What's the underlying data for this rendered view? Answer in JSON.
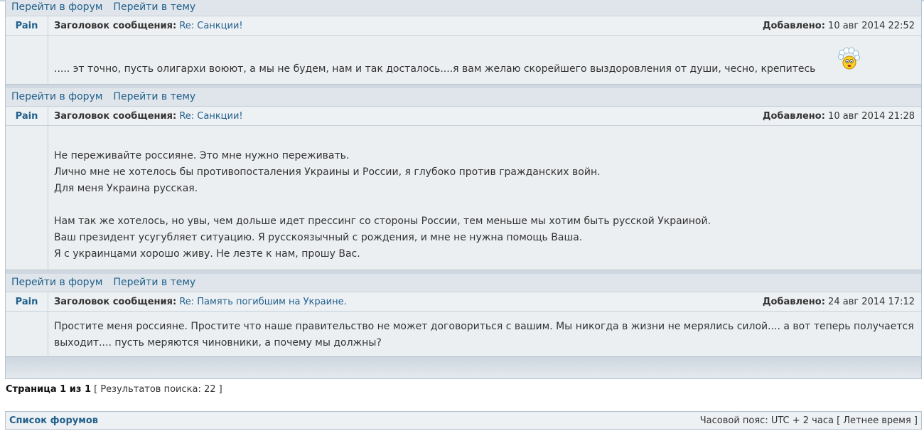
{
  "nav": {
    "forum_link": "Перейти в форум",
    "topic_link": "Перейти в тему"
  },
  "labels": {
    "subject": "Заголовок сообщения:",
    "added": "Добавлено:"
  },
  "posts": [
    {
      "author": "Pain",
      "subject": "Re: Санкции!",
      "date": "10 авг 2014 22:52",
      "lines": [
        "..... эт точно, пусть олигархи воюют, а мы не будем, нам и так досталось....я вам желаю скорейшего выздоровления от души, чесно, крепитесь"
      ]
    },
    {
      "author": "Pain",
      "subject": "Re: Санкции!",
      "date": "10 авг 2014 21:28",
      "lines": [
        "Не переживайте россияне. Это мне нужно переживать.",
        "Лично мне не хотелось бы противопосталения Украины и России, я глубоко против гражданских войн.",
        "Для меня Украина русская.",
        "Нам так же хотелось, но увы, чем дольше идет прессинг со стороны России, тем меньше мы хотим быть русской Украиной.",
        "Ваш президент усугубляет ситуацию. Я русскоязычный с рождения, и мне не нужна помощь Ваша.",
        "Я с украинцами хорошо живу. Не лезте к нам, прошу Вас."
      ]
    },
    {
      "author": "Pain",
      "subject": "Re: Память погибшим на Украине.",
      "date": "24 авг 2014 17:12",
      "lines": [
        "Простите меня россияне. Простите что наше правительство не может договориться с вашим. Мы никогда в жизни не мерялись силой.... а вот теперь получается",
        "выходит.... пусть меряются чиновники, а почему мы должны?"
      ]
    }
  ],
  "pagination": {
    "page_label": "Страница 1 из 1",
    "results": "[ Результатов поиска: 22 ]"
  },
  "footer": {
    "forum_list": "Список форумов",
    "timezone": "Часовой пояс: UTC + 2 часа [ Летнее время ]"
  },
  "icons": {
    "smiley": "smiley-icon"
  }
}
